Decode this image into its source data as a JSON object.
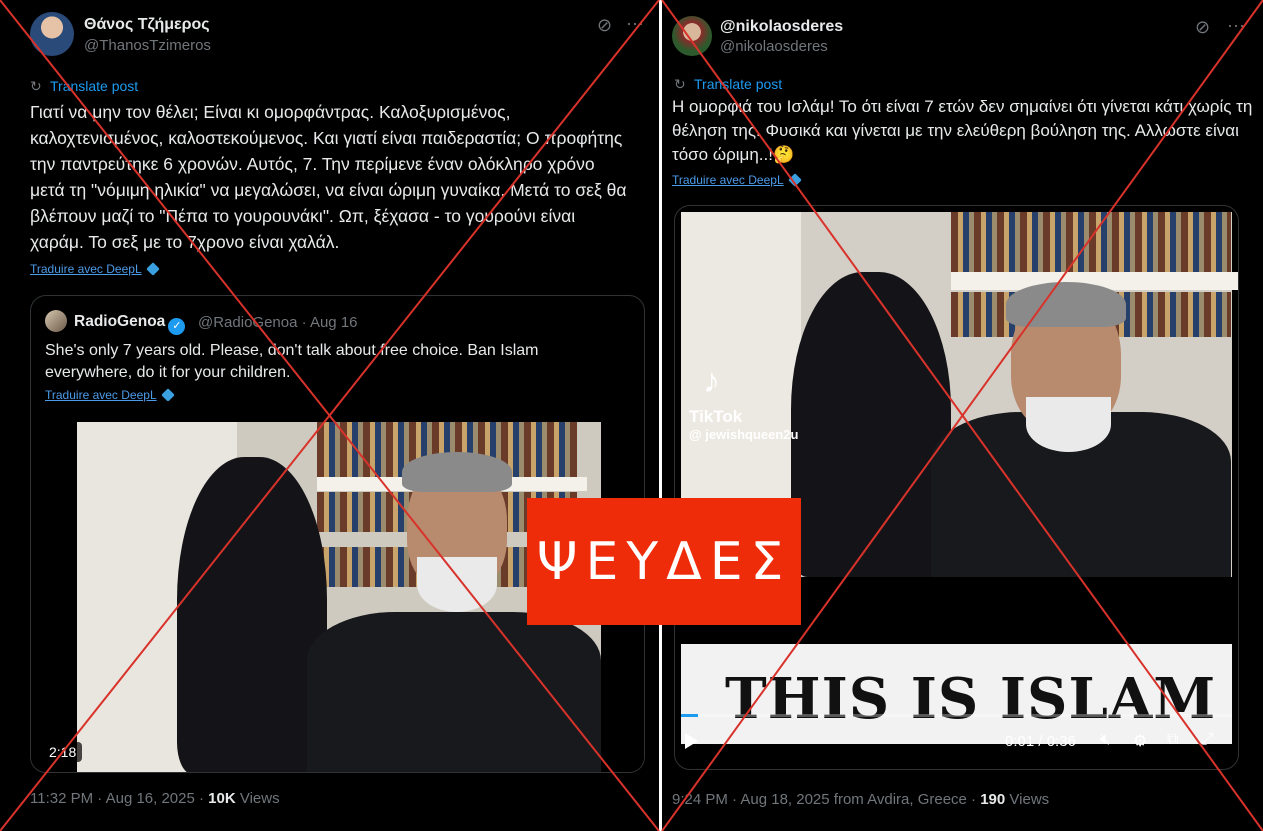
{
  "left_post": {
    "author_name": "Θάνος Τζήμερος",
    "handle": "@ThanosTzimeros",
    "translate_label": "Translate post",
    "text": "Γιατί να μην τον θέλει; Είναι κι ομορφάντρας. Καλοξυρισμένος, καλοχτενισμένος, καλοστεκούμενος. Και γιατί είναι παιδεραστία; Ο προφήτης την παντρεύτηκε 6 χρονών. Αυτός, 7. Την περίμενε έναν ολόκληρο χρόνο μετά τη \"νόμιμη ηλικία\" να μεγαλώσει, να είναι ώριμη γυναίκα. Μετά το σεξ θα βλέπουν μαζί το \"Πέπα το γουρουνάκι\". Ωπ, ξέχασα - το γουρούνι είναι χαράμ. Το σεξ με το 7χρονο είναι χαλάλ.",
    "deepl_label": "Traduire avec DeepL",
    "quote": {
      "author_name": "RadioGenoa",
      "meta": "@RadioGenoa · Aug 16",
      "text": "She's only 7 years old. Please, don't talk about free choice. Ban Islam everywhere, do it for your children.",
      "deepl_label": "Traduire avec DeepL",
      "video_duration": "2:18"
    },
    "timestamp": "11:32 PM · Aug 16, 2025 · ",
    "views_count": "10K",
    "views_label": " Views"
  },
  "right_post": {
    "author_name": "@nikolaosderes",
    "handle": "@nikolaosderes",
    "translate_label": "Translate post",
    "text": "Η ομορφιά του Ισλάμ! Το ότι είναι 7 ετών δεν σημαίνει ότι γίνεται κάτι χωρίς τη θέληση της. Φυσικά και γίνεται με την ελεύθερη βούληση της. Αλλωστε είναι τόσο ώριμη..!🤔",
    "deepl_label": "Traduire avec DeepL",
    "video": {
      "tiktok_label": "TikTok",
      "tiktok_user": "@ jewishqueen2u",
      "banner": "THIS IS ISLAM",
      "time": "0:01 / 0:36",
      "progress": 0.03
    },
    "timestamp": "9:24 PM · Aug 18, 2025 from Avdira, Greece · ",
    "views_count": "190",
    "views_label": " Views"
  },
  "stamp": {
    "label": "ΨΕΥΔΕΣ",
    "color": "#ef2c0a"
  },
  "colors": {
    "background": "#000000",
    "link": "#1d9bf0",
    "muted": "#71767b",
    "cross": "#d8322a"
  }
}
